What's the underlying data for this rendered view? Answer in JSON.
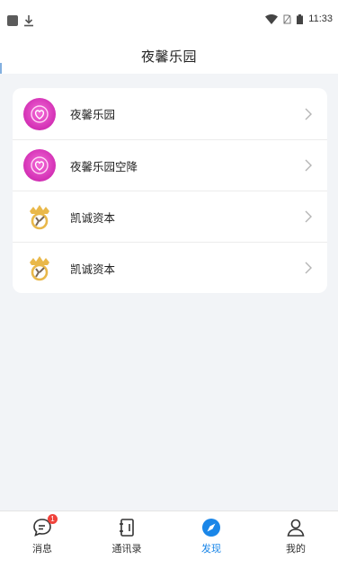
{
  "status_bar": {
    "time": "11:33"
  },
  "nav": {
    "title": "夜馨乐园"
  },
  "list": {
    "items": [
      {
        "label": "夜馨乐园",
        "icon": "heart-logo-icon"
      },
      {
        "label": "夜馨乐园空降",
        "icon": "heart-logo-icon"
      },
      {
        "label": "凯诚资本",
        "icon": "crown-logo-icon"
      },
      {
        "label": "凯诚资本",
        "icon": "crown-logo-icon"
      }
    ]
  },
  "tabs": [
    {
      "label": "消息",
      "icon": "chat-icon",
      "badge": "1"
    },
    {
      "label": "通讯录",
      "icon": "contacts-book-icon"
    },
    {
      "label": "发现",
      "icon": "compass-icon",
      "active": true
    },
    {
      "label": "我的",
      "icon": "person-icon"
    }
  ],
  "colors": {
    "accent": "#1a86e8",
    "badge": "#f0423b",
    "background": "#f2f4f7"
  }
}
